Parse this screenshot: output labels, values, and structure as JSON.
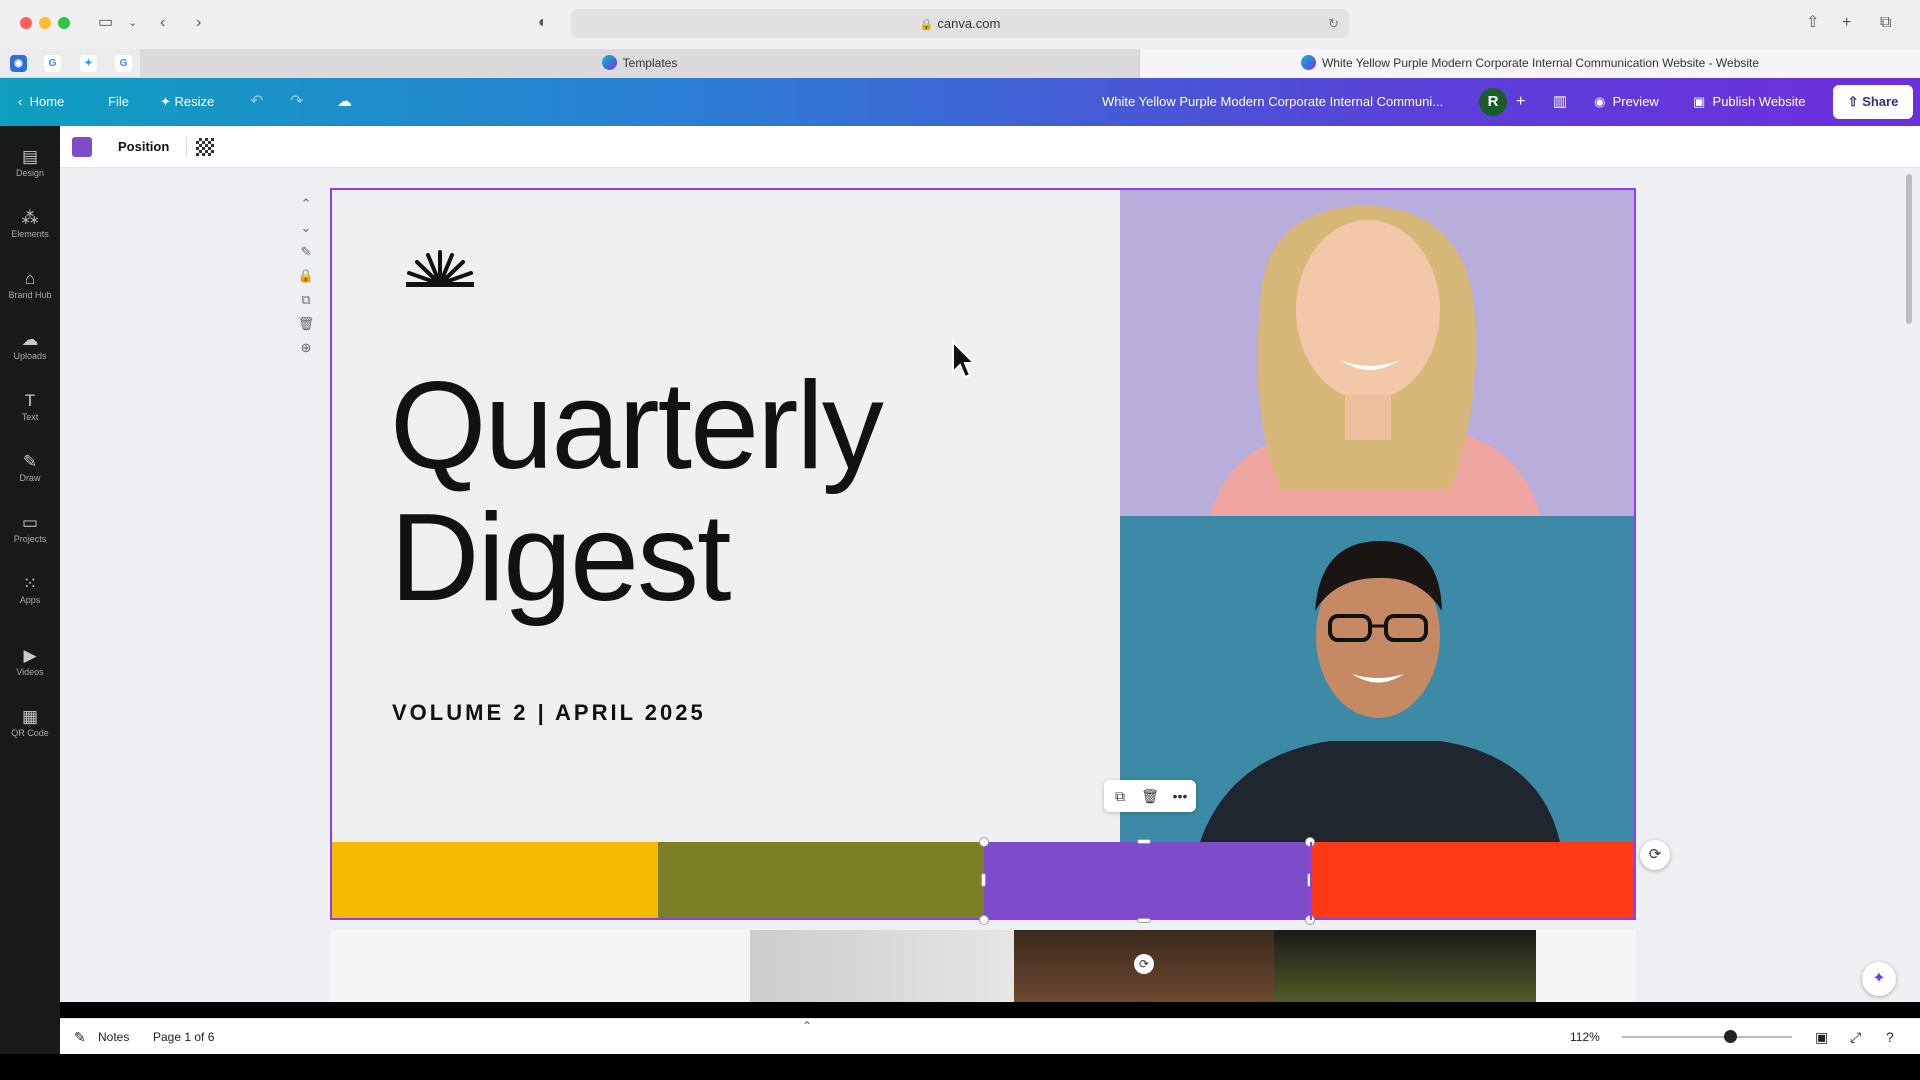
{
  "browser": {
    "url": "canva.com",
    "tabs": [
      {
        "label": "Templates"
      },
      {
        "label": "White Yellow Purple Modern Corporate Internal Communication Website - Website"
      }
    ]
  },
  "topbar": {
    "home": "Home",
    "file": "File",
    "resize": "Resize",
    "doc_title": "White Yellow Purple Modern Corporate  Internal Communi...",
    "avatar_initial": "R",
    "preview": "Preview",
    "publish": "Publish Website",
    "share": "Share"
  },
  "context_toolbar": {
    "swatch_color": "#7e4cc8",
    "position": "Position"
  },
  "sidebar": {
    "items": [
      {
        "label": "Design",
        "icon": "design-icon"
      },
      {
        "label": "Elements",
        "icon": "elements-icon"
      },
      {
        "label": "Brand Hub",
        "icon": "brand-hub-icon"
      },
      {
        "label": "Uploads",
        "icon": "uploads-icon"
      },
      {
        "label": "Text",
        "icon": "text-icon"
      },
      {
        "label": "Draw",
        "icon": "draw-icon"
      },
      {
        "label": "Projects",
        "icon": "projects-icon"
      },
      {
        "label": "Apps",
        "icon": "apps-icon"
      },
      {
        "label": "Videos",
        "icon": "videos-icon"
      },
      {
        "label": "QR Code",
        "icon": "qr-code-icon"
      }
    ]
  },
  "page": {
    "headline_line1": "Quarterly",
    "headline_line2": "Digest",
    "subline": "VOLUME 2 | APRIL 2025",
    "bar_colors": [
      "#f4b900",
      "#7a8023",
      "#7e4cc8",
      "#ff3a14"
    ]
  },
  "bottombar": {
    "notes": "Notes",
    "page_indicator": "Page 1 of 6",
    "zoom": "112%"
  }
}
